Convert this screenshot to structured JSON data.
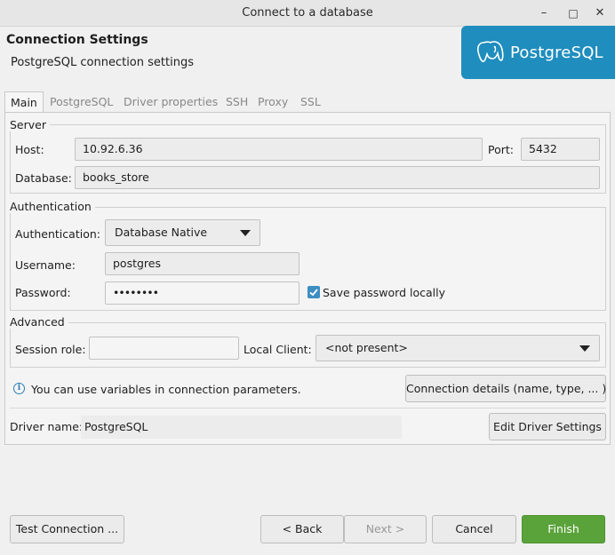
{
  "window": {
    "title": "Connect to a database",
    "minimize_glyph": "–",
    "maximize_glyph": "□",
    "close_glyph": "✕"
  },
  "header": {
    "title": "Connection Settings",
    "subtitle": "PostgreSQL connection settings",
    "logo_text": "PostgreSQL",
    "logo_icon": "postgresql-elephant-icon",
    "logo_color": "#1f8dbd"
  },
  "tabs": [
    {
      "label": "Main",
      "active": true
    },
    {
      "label": "PostgreSQL",
      "active": false
    },
    {
      "label": "Driver properties",
      "active": false
    },
    {
      "label": "SSH",
      "active": false
    },
    {
      "label": "Proxy",
      "active": false
    },
    {
      "label": "SSL",
      "active": false
    }
  ],
  "server": {
    "group_label": "Server",
    "host_label": "Host:",
    "host_value": "10.92.6.36",
    "port_label": "Port:",
    "port_value": "5432",
    "database_label": "Database:",
    "database_value": "books_store"
  },
  "authentication": {
    "group_label": "Authentication",
    "auth_label": "Authentication:",
    "auth_value": "Database Native",
    "username_label": "Username:",
    "username_value": "postgres",
    "password_label": "Password:",
    "password_value": "••••••••",
    "save_password_label": "Save password locally",
    "save_password_checked": true
  },
  "advanced": {
    "group_label": "Advanced",
    "session_role_label": "Session role:",
    "session_role_value": "",
    "local_client_label": "Local Client:",
    "local_client_value": "<not present>"
  },
  "info": {
    "text": "You can use variables in connection parameters.",
    "details_button": "Connection details (name, type, ... )"
  },
  "driver": {
    "label": "Driver name:",
    "value": "PostgreSQL",
    "edit_button": "Edit Driver Settings"
  },
  "footer": {
    "test_button": "Test Connection ...",
    "back_button": "< Back",
    "next_button": "Next >",
    "cancel_button": "Cancel",
    "finish_button": "Finish",
    "finish_color": "#5aa33b"
  }
}
